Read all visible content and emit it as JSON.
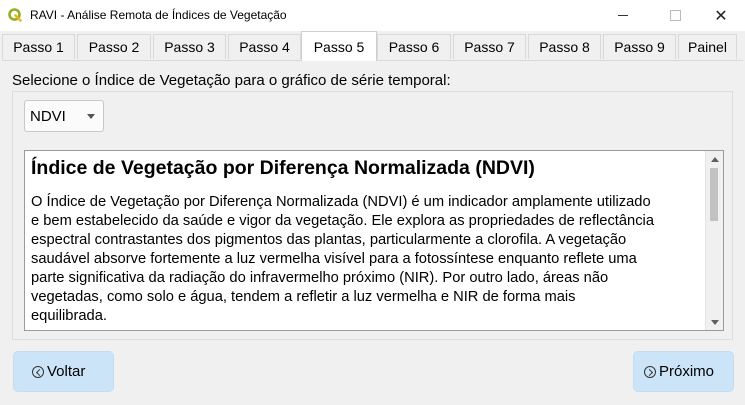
{
  "window": {
    "title": "RAVI - Análise Remota de Índices de Vegetação",
    "close_glyph": "✕"
  },
  "tabs": [
    {
      "label": "Passo 1"
    },
    {
      "label": "Passo 2"
    },
    {
      "label": "Passo 3"
    },
    {
      "label": "Passo 4"
    },
    {
      "label": "Passo 5",
      "active": true
    },
    {
      "label": "Passo 6"
    },
    {
      "label": "Passo 7"
    },
    {
      "label": "Passo 8"
    },
    {
      "label": "Passo 9"
    },
    {
      "label": "Painel"
    }
  ],
  "main": {
    "prompt": "Selecione o Índice de Vegetação para o gráfico de série temporal:",
    "index_select": {
      "value": "NDVI"
    },
    "description": {
      "heading": "Índice de Vegetação por Diferença Normalizada (NDVI)",
      "lines": [
        "O Índice de Vegetação por Diferença Normalizada (NDVI) é um indicador amplamente utilizado",
        "e bem estabelecido da saúde e vigor da vegetação. Ele explora as propriedades de reflectância",
        "espectral contrastantes dos pigmentos das plantas, particularmente a clorofila. A vegetação",
        "saudável absorve fortemente a luz vermelha visível para a fotossíntese enquanto reflete uma",
        "parte significativa da radiação do infravermelho próximo (NIR). Por outro lado, áreas não",
        "vegetadas, como solo e água, tendem a refletir a luz vermelha e NIR de forma mais",
        "equilibrada."
      ]
    }
  },
  "footer": {
    "back_label": "Voltar",
    "next_label": "Próximo"
  },
  "colors": {
    "button_bg": "#cce4f7",
    "window_bg": "#f0f0f0",
    "qgis_green": "#93b023"
  },
  "icons": {
    "app": "qgis-logo-icon",
    "back": "circle-arrow-left-icon",
    "next": "circle-arrow-right-icon"
  }
}
